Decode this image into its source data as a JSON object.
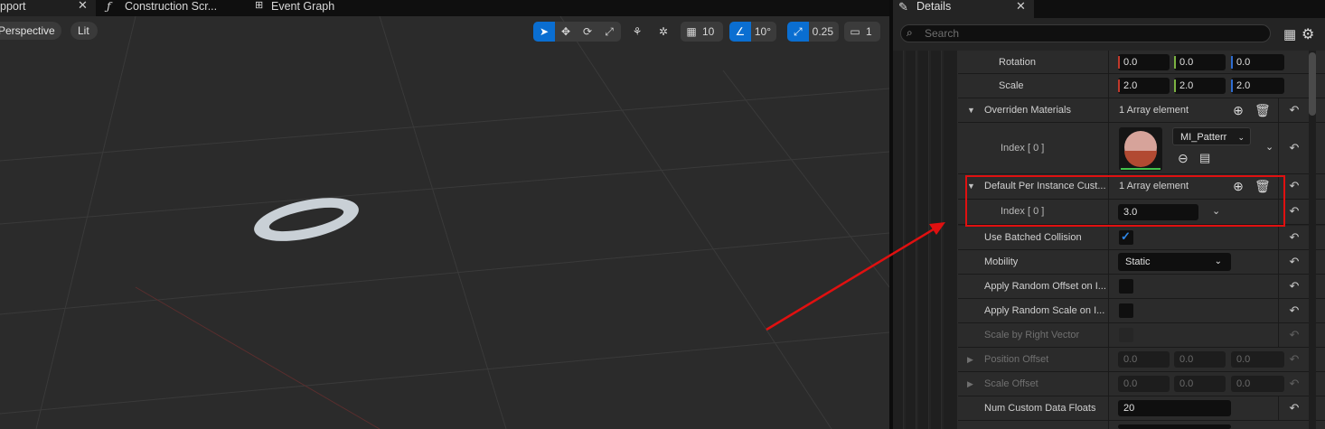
{
  "tabs": {
    "viewport": "pport",
    "construction": "Construction Scr...",
    "event_graph": "Event Graph",
    "details": "Details"
  },
  "viewport": {
    "perspective": "Perspective",
    "lit": "Lit",
    "grid_snap": "10",
    "rotation_snap": "10°",
    "scale_snap": "0.25",
    "camera_speed": "1"
  },
  "details": {
    "search_placeholder": "Search",
    "rotation": {
      "label": "Rotation",
      "x": "0.0",
      "y": "0.0",
      "z": "0.0"
    },
    "scale": {
      "label": "Scale",
      "x": "2.0",
      "y": "2.0",
      "z": "2.0"
    },
    "overriden_materials": {
      "label": "Overriden Materials",
      "value": "1 Array element"
    },
    "material_index": {
      "label": "Index [ 0 ]",
      "asset": "MI_Patterr"
    },
    "default_custom": {
      "label": "Default Per Instance Cust...",
      "value": "1 Array element"
    },
    "custom_index": {
      "label": "Index [ 0 ]",
      "value": "3.0"
    },
    "batched_collision": {
      "label": "Use Batched Collision",
      "checked": true
    },
    "mobility": {
      "label": "Mobility",
      "value": "Static"
    },
    "random_offset": {
      "label": "Apply Random Offset on I..."
    },
    "random_scale": {
      "label": "Apply Random Scale on I..."
    },
    "scale_right": {
      "label": "Scale by Right Vector"
    },
    "position_offset": {
      "label": "Position Offset",
      "x": "0.0",
      "y": "0.0",
      "z": "0.0"
    },
    "scale_offset": {
      "label": "Scale Offset",
      "x": "0.0",
      "y": "0.0",
      "z": "0.0"
    },
    "num_floats": {
      "label": "Num Custom Data Floats",
      "value": "20"
    }
  },
  "colors": {
    "highlight_box": "#e01010",
    "arrow": "#e01010",
    "accent": "#0a6ed1",
    "axis_x": "#c0392b",
    "axis_y": "#7cb342",
    "axis_z": "#2e6dd1"
  }
}
